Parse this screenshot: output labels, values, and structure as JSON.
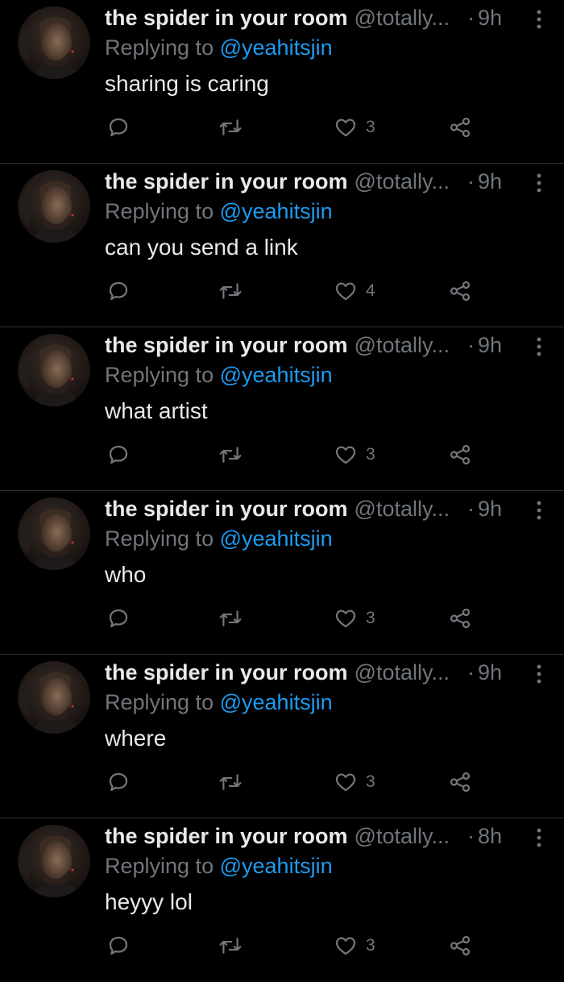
{
  "colors": {
    "background": "#000000",
    "text_primary": "#e7e9ea",
    "text_secondary": "#71767b",
    "accent": "#1d9bf0",
    "divider": "#2f3336"
  },
  "icons": {
    "avatar": "profile-photo",
    "more": "vertical-ellipsis-icon",
    "reply": "speech-bubble-icon",
    "retweet": "retweet-arrows-icon",
    "like": "heart-icon",
    "share": "share-nodes-icon"
  },
  "tweets": [
    {
      "name": "the spider in your room",
      "handle": "@totally...",
      "dot": "·",
      "time": "9h",
      "replying_prefix": "Replying to",
      "replying_to": "@yeahitsjin",
      "text": "sharing is caring",
      "likes": "3"
    },
    {
      "name": "the spider in your room",
      "handle": "@totally...",
      "dot": "·",
      "time": "9h",
      "replying_prefix": "Replying to",
      "replying_to": "@yeahitsjin",
      "text": "can you send a link",
      "likes": "4"
    },
    {
      "name": "the spider in your room",
      "handle": "@totally...",
      "dot": "·",
      "time": "9h",
      "replying_prefix": "Replying to",
      "replying_to": "@yeahitsjin",
      "text": "what artist",
      "likes": "3"
    },
    {
      "name": "the spider in your room",
      "handle": "@totally...",
      "dot": "·",
      "time": "9h",
      "replying_prefix": "Replying to",
      "replying_to": "@yeahitsjin",
      "text": "who",
      "likes": "3"
    },
    {
      "name": "the spider in your room",
      "handle": "@totally...",
      "dot": "·",
      "time": "9h",
      "replying_prefix": "Replying to",
      "replying_to": "@yeahitsjin",
      "text": "where",
      "likes": "3"
    },
    {
      "name": "the spider in your room",
      "handle": "@totally...",
      "dot": "·",
      "time": "8h",
      "replying_prefix": "Replying to",
      "replying_to": "@yeahitsjin",
      "text": "heyyy lol",
      "likes": "3"
    }
  ]
}
